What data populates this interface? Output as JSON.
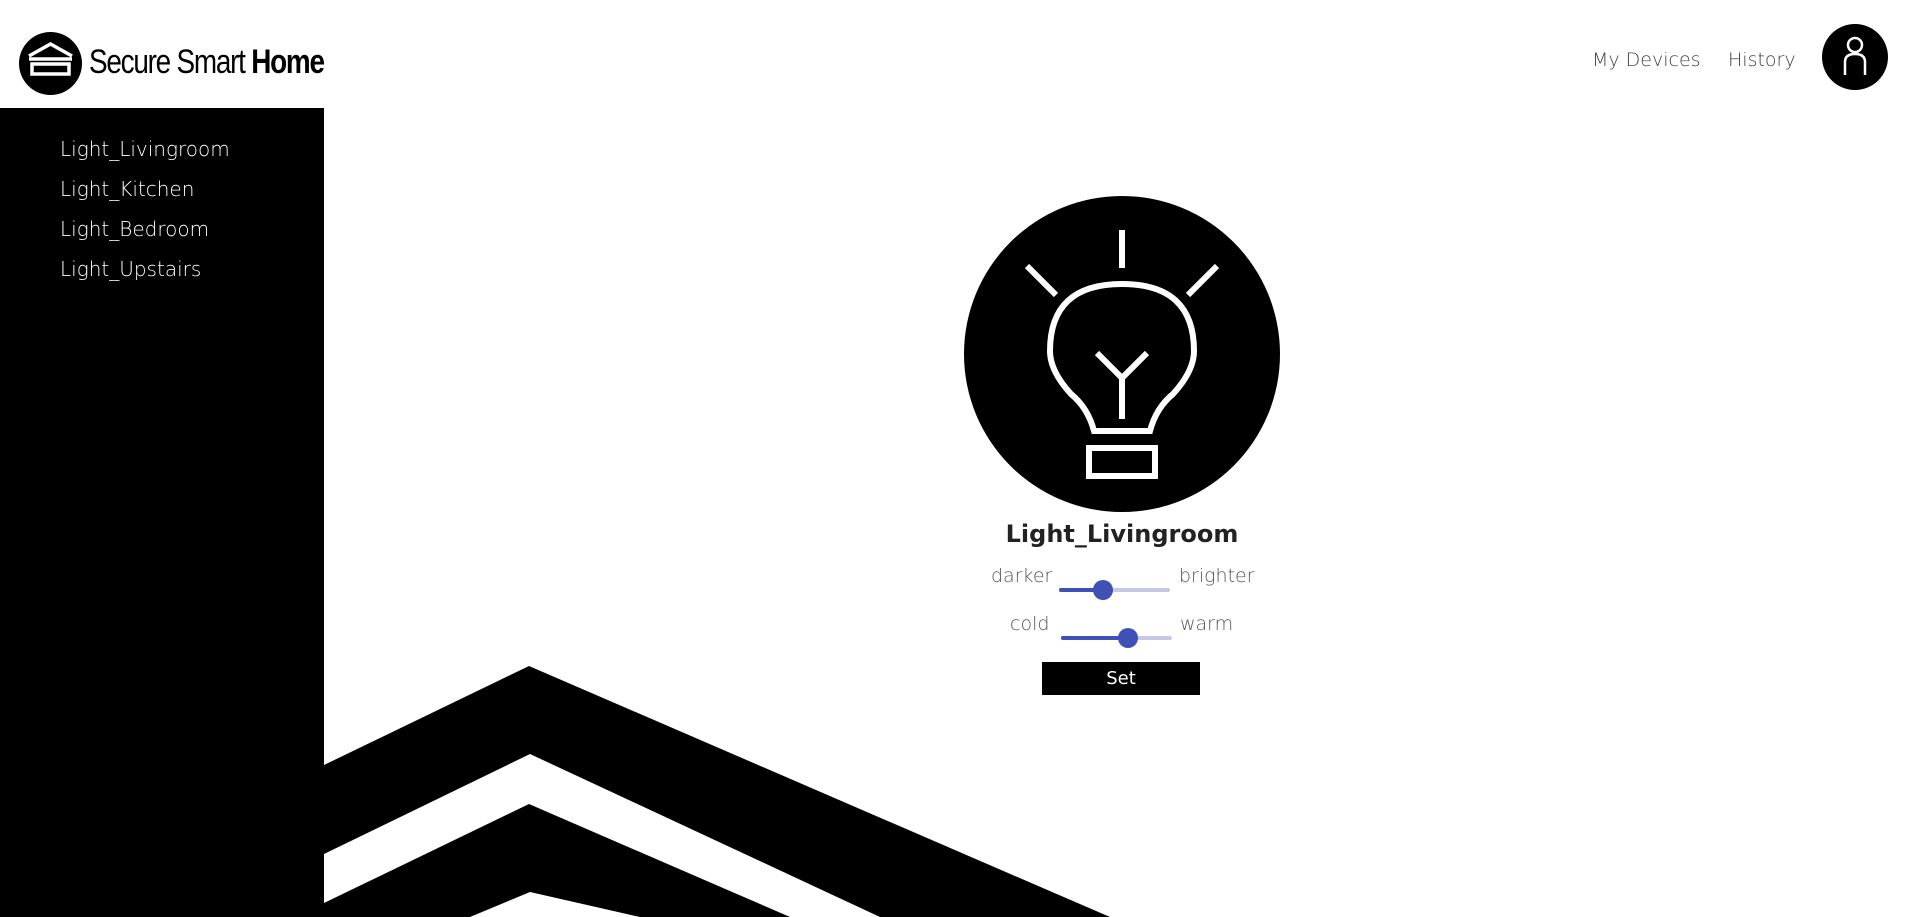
{
  "header": {
    "brand_light": "Secure Smart ",
    "brand_bold": "Home",
    "logo_icon": "house-icon",
    "nav": [
      {
        "label": "My Devices"
      },
      {
        "label": "History"
      }
    ],
    "avatar_icon": "user-icon"
  },
  "sidebar": {
    "items": [
      {
        "label": "Light_Livingroom"
      },
      {
        "label": "Light_Kitchen"
      },
      {
        "label": "Light_Bedroom"
      },
      {
        "label": "Light_Upstairs"
      }
    ]
  },
  "device": {
    "icon": "lightbulb-icon",
    "name": "Light_Livingroom",
    "brightness": {
      "left_label": "darker",
      "right_label": "brighter",
      "value": 0.4
    },
    "temperature": {
      "left_label": "cold",
      "right_label": "warm",
      "value": 0.6
    },
    "set_label": "Set"
  },
  "colors": {
    "accent": "#3f51b5",
    "track": "#c5c9e6",
    "black": "#000000",
    "background": "#ffffff"
  }
}
